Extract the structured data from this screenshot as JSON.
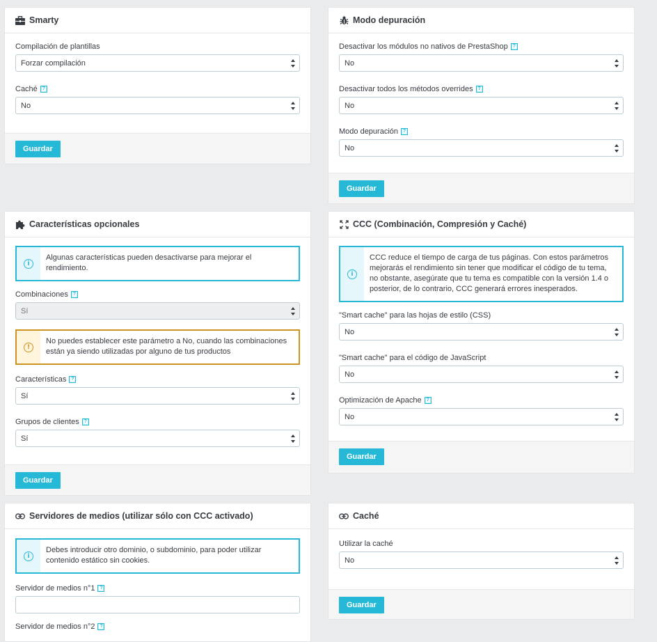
{
  "smarty": {
    "title": "Smarty",
    "icon": "briefcase-icon",
    "compile_label": "Compilación de plantillas",
    "compile_value": "Forzar compilación",
    "cache_label": "Caché",
    "cache_value": "No",
    "save": "Guardar"
  },
  "debug": {
    "title": "Modo depuración",
    "icon": "bug-icon",
    "nonnative_label": "Desactivar los módulos no nativos de PrestaShop",
    "nonnative_value": "No",
    "overrides_label": "Desactivar todos los métodos overrides",
    "overrides_value": "No",
    "debug_label": "Modo depuración",
    "debug_value": "No",
    "save": "Guardar"
  },
  "optional": {
    "title": "Características opcionales",
    "icon": "puzzle-icon",
    "info": "Algunas características pueden desactivarse para mejorar el rendimiento.",
    "combinations_label": "Combinaciones",
    "combinations_value": "Sí",
    "warning": "No puedes establecer este parámetro a No, cuando las combinaciones están ya siendo utilizadas por alguno de tus productos",
    "features_label": "Características",
    "features_value": "Sí",
    "groups_label": "Grupos de clientes",
    "groups_value": "Sí",
    "save": "Guardar"
  },
  "ccc": {
    "title": "CCC (Combinación, Compresión y Caché)",
    "icon": "fullscreen-icon",
    "info": "CCC reduce el tiempo de carga de tus páginas. Con estos parámetros mejorarás el rendimiento sin tener que modificar el código de tu tema, no obstante, asegúrate que tu tema es compatible con la versión 1.4 o posterior, de lo contrario, CCC generará errores inesperados.",
    "css_label": "\"Smart cache\" para las hojas de estilo (CSS)",
    "css_value": "No",
    "js_label": "\"Smart cache\" para el código de JavaScript",
    "js_value": "No",
    "apache_label": "Optimización de Apache",
    "apache_value": "No",
    "save": "Guardar"
  },
  "media": {
    "title": "Servidores de medios (utilizar sólo con CCC activado)",
    "icon": "link-icon",
    "info": "Debes introducir otro dominio, o subdominio, para poder utilizar contenido estático sin cookies.",
    "server1_label": "Servidor de medios n°1",
    "server1_value": "",
    "server2_label": "Servidor de medios n°2"
  },
  "cache": {
    "title": "Caché",
    "icon": "link-icon",
    "use_label": "Utilizar la caché",
    "use_value": "No",
    "save": "Guardar"
  },
  "colors": {
    "accent": "#25b9d7",
    "warning": "#cd9321",
    "background": "#eaebed"
  }
}
